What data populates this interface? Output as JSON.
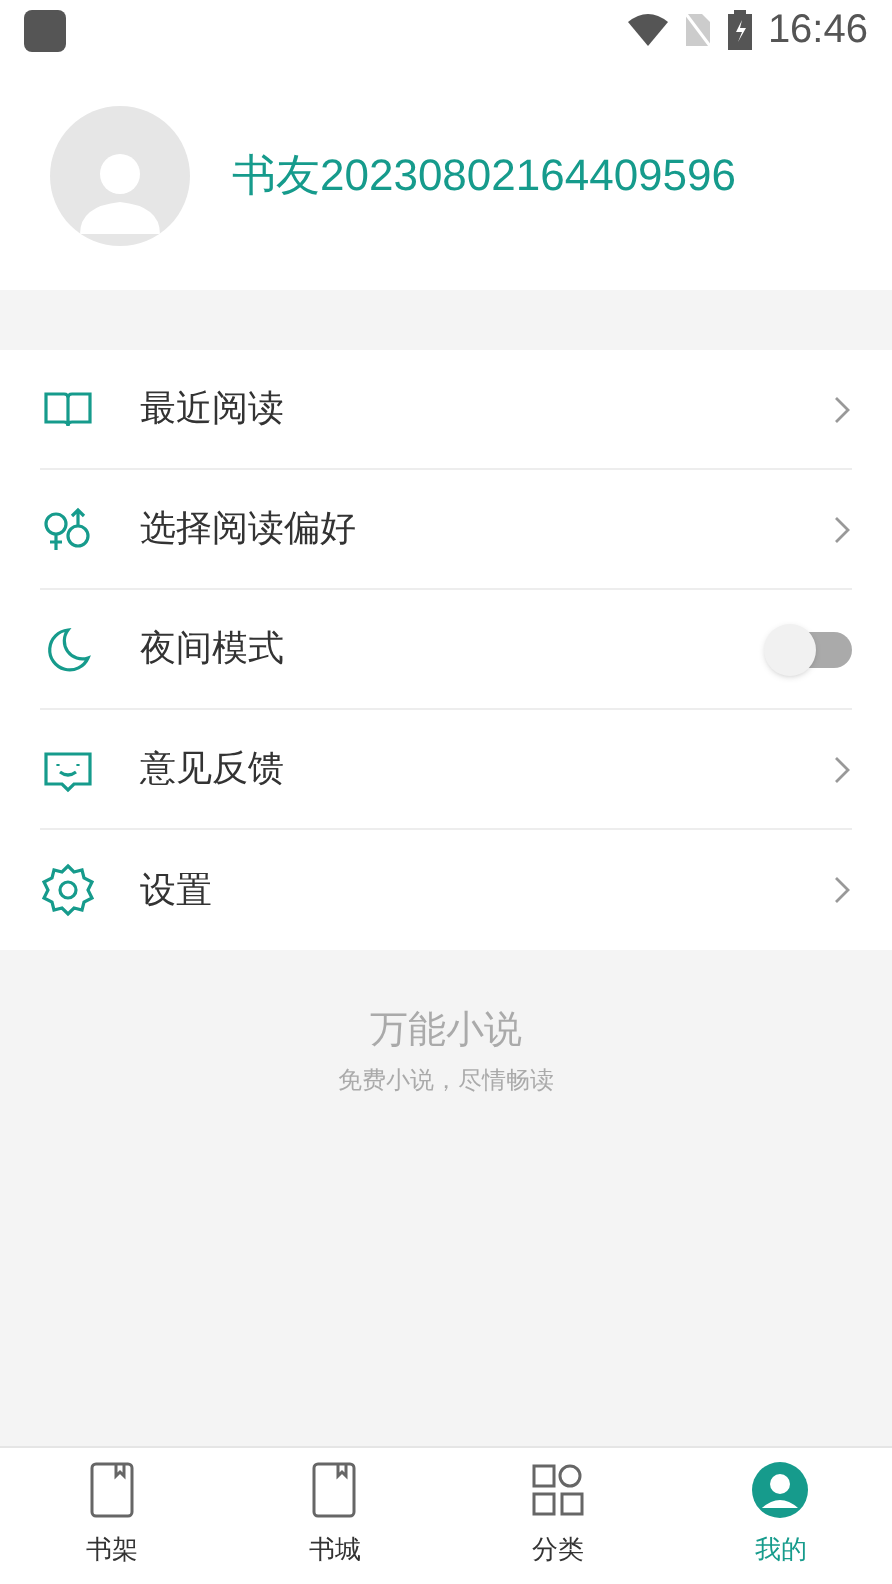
{
  "status_bar": {
    "time": "16:46"
  },
  "profile": {
    "username": "书友20230802164409596"
  },
  "menu": [
    {
      "label": "最近阅读",
      "kind": "link"
    },
    {
      "label": "选择阅读偏好",
      "kind": "link"
    },
    {
      "label": "夜间模式",
      "kind": "toggle",
      "on": false
    },
    {
      "label": "意见反馈",
      "kind": "link"
    },
    {
      "label": "设置",
      "kind": "link"
    }
  ],
  "footer": {
    "app_name": "万能小说",
    "slogan": "免费小说，尽情畅读"
  },
  "tabs": [
    {
      "label": "书架",
      "selected": false
    },
    {
      "label": "书城",
      "selected": false
    },
    {
      "label": "分类",
      "selected": false
    },
    {
      "label": "我的",
      "selected": true
    }
  ]
}
